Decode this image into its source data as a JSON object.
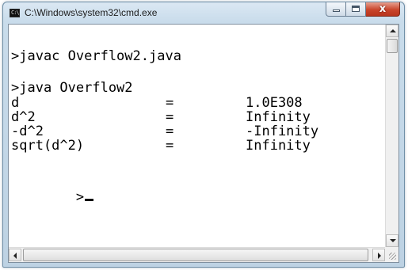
{
  "window": {
    "title": "C:\\Windows\\system32\\cmd.exe",
    "icon_text": "C:\\",
    "close_glyph": "x"
  },
  "console": {
    "command1": ">javac Overflow2.java",
    "command2": ">java Overflow2",
    "rows": [
      {
        "label": "d",
        "eq": "=",
        "value": "1.0E308"
      },
      {
        "label": "d^2",
        "eq": "=",
        "value": "Infinity"
      },
      {
        "label": "-d^2",
        "eq": "=",
        "value": "-Infinity"
      },
      {
        "label": "sqrt(d^2)",
        "eq": "=",
        "value": "Infinity"
      }
    ],
    "prompt": ">"
  },
  "colors": {
    "console_bg": "#ffffff",
    "console_text": "#000000",
    "close_button": "#c9452b"
  }
}
